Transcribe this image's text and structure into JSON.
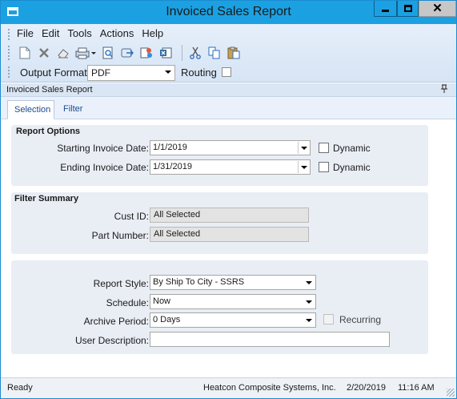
{
  "window": {
    "title": "Invoiced Sales Report"
  },
  "menu": [
    "File",
    "Edit",
    "Tools",
    "Actions",
    "Help"
  ],
  "toolbar": {
    "icons": [
      "new-icon",
      "delete-icon",
      "eraser-icon",
      "print-icon",
      "print-preview-icon",
      "send-icon",
      "generate-icon",
      "excel-icon",
      "cut-icon",
      "copy-icon",
      "paste-icon"
    ],
    "output_format_label": "Output Format:",
    "output_format_value": "PDF",
    "routing_label": "Routing"
  },
  "panel": {
    "title": "Invoiced Sales Report"
  },
  "tabs": [
    {
      "label": "Selection",
      "active": true
    },
    {
      "label": "Filter",
      "active": false
    }
  ],
  "report_options": {
    "title": "Report Options",
    "start_label": "Starting Invoice Date:",
    "start_value": "1/1/2019",
    "end_label": "Ending Invoice Date:",
    "end_value": "1/31/2019",
    "dynamic_label": "Dynamic"
  },
  "filter_summary": {
    "title": "Filter Summary",
    "cust_label": "Cust ID:",
    "cust_value": "All Selected",
    "part_label": "Part Number:",
    "part_value": "All Selected"
  },
  "settings": {
    "style_label": "Report Style:",
    "style_value": "By Ship To City - SSRS",
    "schedule_label": "Schedule:",
    "schedule_value": "Now",
    "archive_label": "Archive Period:",
    "archive_value": "0 Days",
    "recurring_label": "Recurring",
    "desc_label": "User Description:",
    "desc_value": ""
  },
  "status": {
    "state": "Ready",
    "company": "Heatcon Composite Systems, Inc.",
    "date": "2/20/2019",
    "time": "11:16 AM"
  },
  "colors": {
    "titlebar": "#1ba1e2",
    "group_bg": "#e9eef5"
  }
}
